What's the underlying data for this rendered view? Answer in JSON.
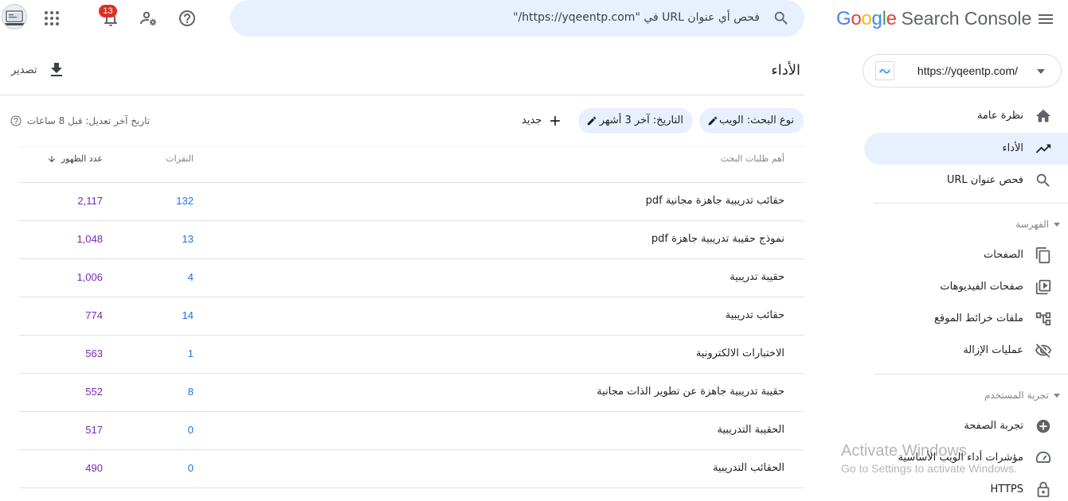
{
  "app": {
    "brand_google": [
      "G",
      "o",
      "o",
      "g",
      "l",
      "e"
    ],
    "brand_product": "Search Console"
  },
  "search": {
    "text": "فحص أي عنوان URL في \"https://yqeentp.com/\""
  },
  "notifications": {
    "count": "13"
  },
  "property": {
    "url": "https://yqeentp.com/"
  },
  "sidebar": {
    "items": [
      {
        "label": "نظرة عامة",
        "icon": "home-icon"
      },
      {
        "label": "الأداء",
        "icon": "trending-up-icon",
        "active": true
      },
      {
        "label": "فحص عنوان URL",
        "icon": "search-icon"
      }
    ],
    "section_indexing": "الفهرسة",
    "indexing_items": [
      {
        "label": "الصفحات",
        "icon": "pages-icon"
      },
      {
        "label": "صفحات الفيديوهات",
        "icon": "video-pages-icon"
      },
      {
        "label": "ملفات خرائط الموقع",
        "icon": "sitemap-icon"
      },
      {
        "label": "عمليات الإزالة",
        "icon": "removals-icon"
      }
    ],
    "section_experience": "تجربة المستخدم",
    "experience_items": [
      {
        "label": "تجربة الصفحة",
        "icon": "page-experience-icon"
      },
      {
        "label": "مؤشرات أداء الويب الأساسية",
        "icon": "speedometer-icon"
      },
      {
        "label": "HTTPS",
        "icon": "lock-icon"
      }
    ]
  },
  "main": {
    "title": "الأداء",
    "export_label": "تصدير",
    "filters": {
      "search_type": "نوع البحث: الويب",
      "date": "التاريخ: آخر 3 أشهر",
      "new_label": "جديد"
    },
    "last_updated": "تاريخ آخر تعديل: قبل 8 ساعات"
  },
  "table": {
    "headers": {
      "query": "أهم طلبات البحث",
      "clicks": "النقرات",
      "impressions": "عدد الظهور"
    },
    "rows": [
      {
        "query": "حقائب تدريبية جاهزة مجانية pdf",
        "clicks": "132",
        "impressions": "2,117"
      },
      {
        "query": "نموذج حقيبة تدريبية جاهزة pdf",
        "clicks": "13",
        "impressions": "1,048"
      },
      {
        "query": "حقيبة تدريبية",
        "clicks": "4",
        "impressions": "1,006"
      },
      {
        "query": "حقائب تدريبية",
        "clicks": "14",
        "impressions": "774"
      },
      {
        "query": "الاختبارات الالكترونية",
        "clicks": "1",
        "impressions": "563"
      },
      {
        "query": "حقيبة تدريبية جاهزة عن تطوير الذات مجانية",
        "clicks": "8",
        "impressions": "552"
      },
      {
        "query": "الحقيبة التدريبية",
        "clicks": "0",
        "impressions": "517"
      },
      {
        "query": "الحقائب التدريبية",
        "clicks": "0",
        "impressions": "490"
      }
    ]
  },
  "watermark": {
    "line1": "Activate Windows",
    "line2": "Go to Settings to activate Windows."
  },
  "colors": {
    "accent": "#1a73e8",
    "active_bg": "#e8f0fe",
    "clicks": "#1a73e8",
    "impressions": "#7627bb",
    "badge": "#d93025"
  }
}
